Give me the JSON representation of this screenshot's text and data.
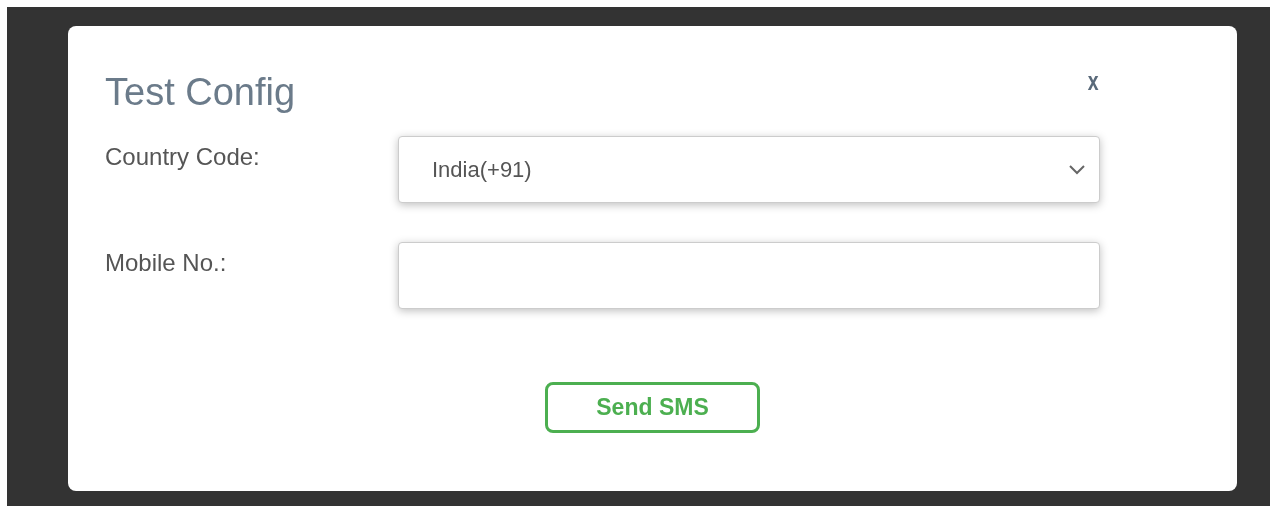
{
  "dialog": {
    "title": "Test Config",
    "close": "x",
    "fields": [
      {
        "kind": "select",
        "label": "Country Code:",
        "value": "India(+91)"
      },
      {
        "kind": "input",
        "label": "Mobile No.:"
      }
    ],
    "button": "Send SMS"
  }
}
